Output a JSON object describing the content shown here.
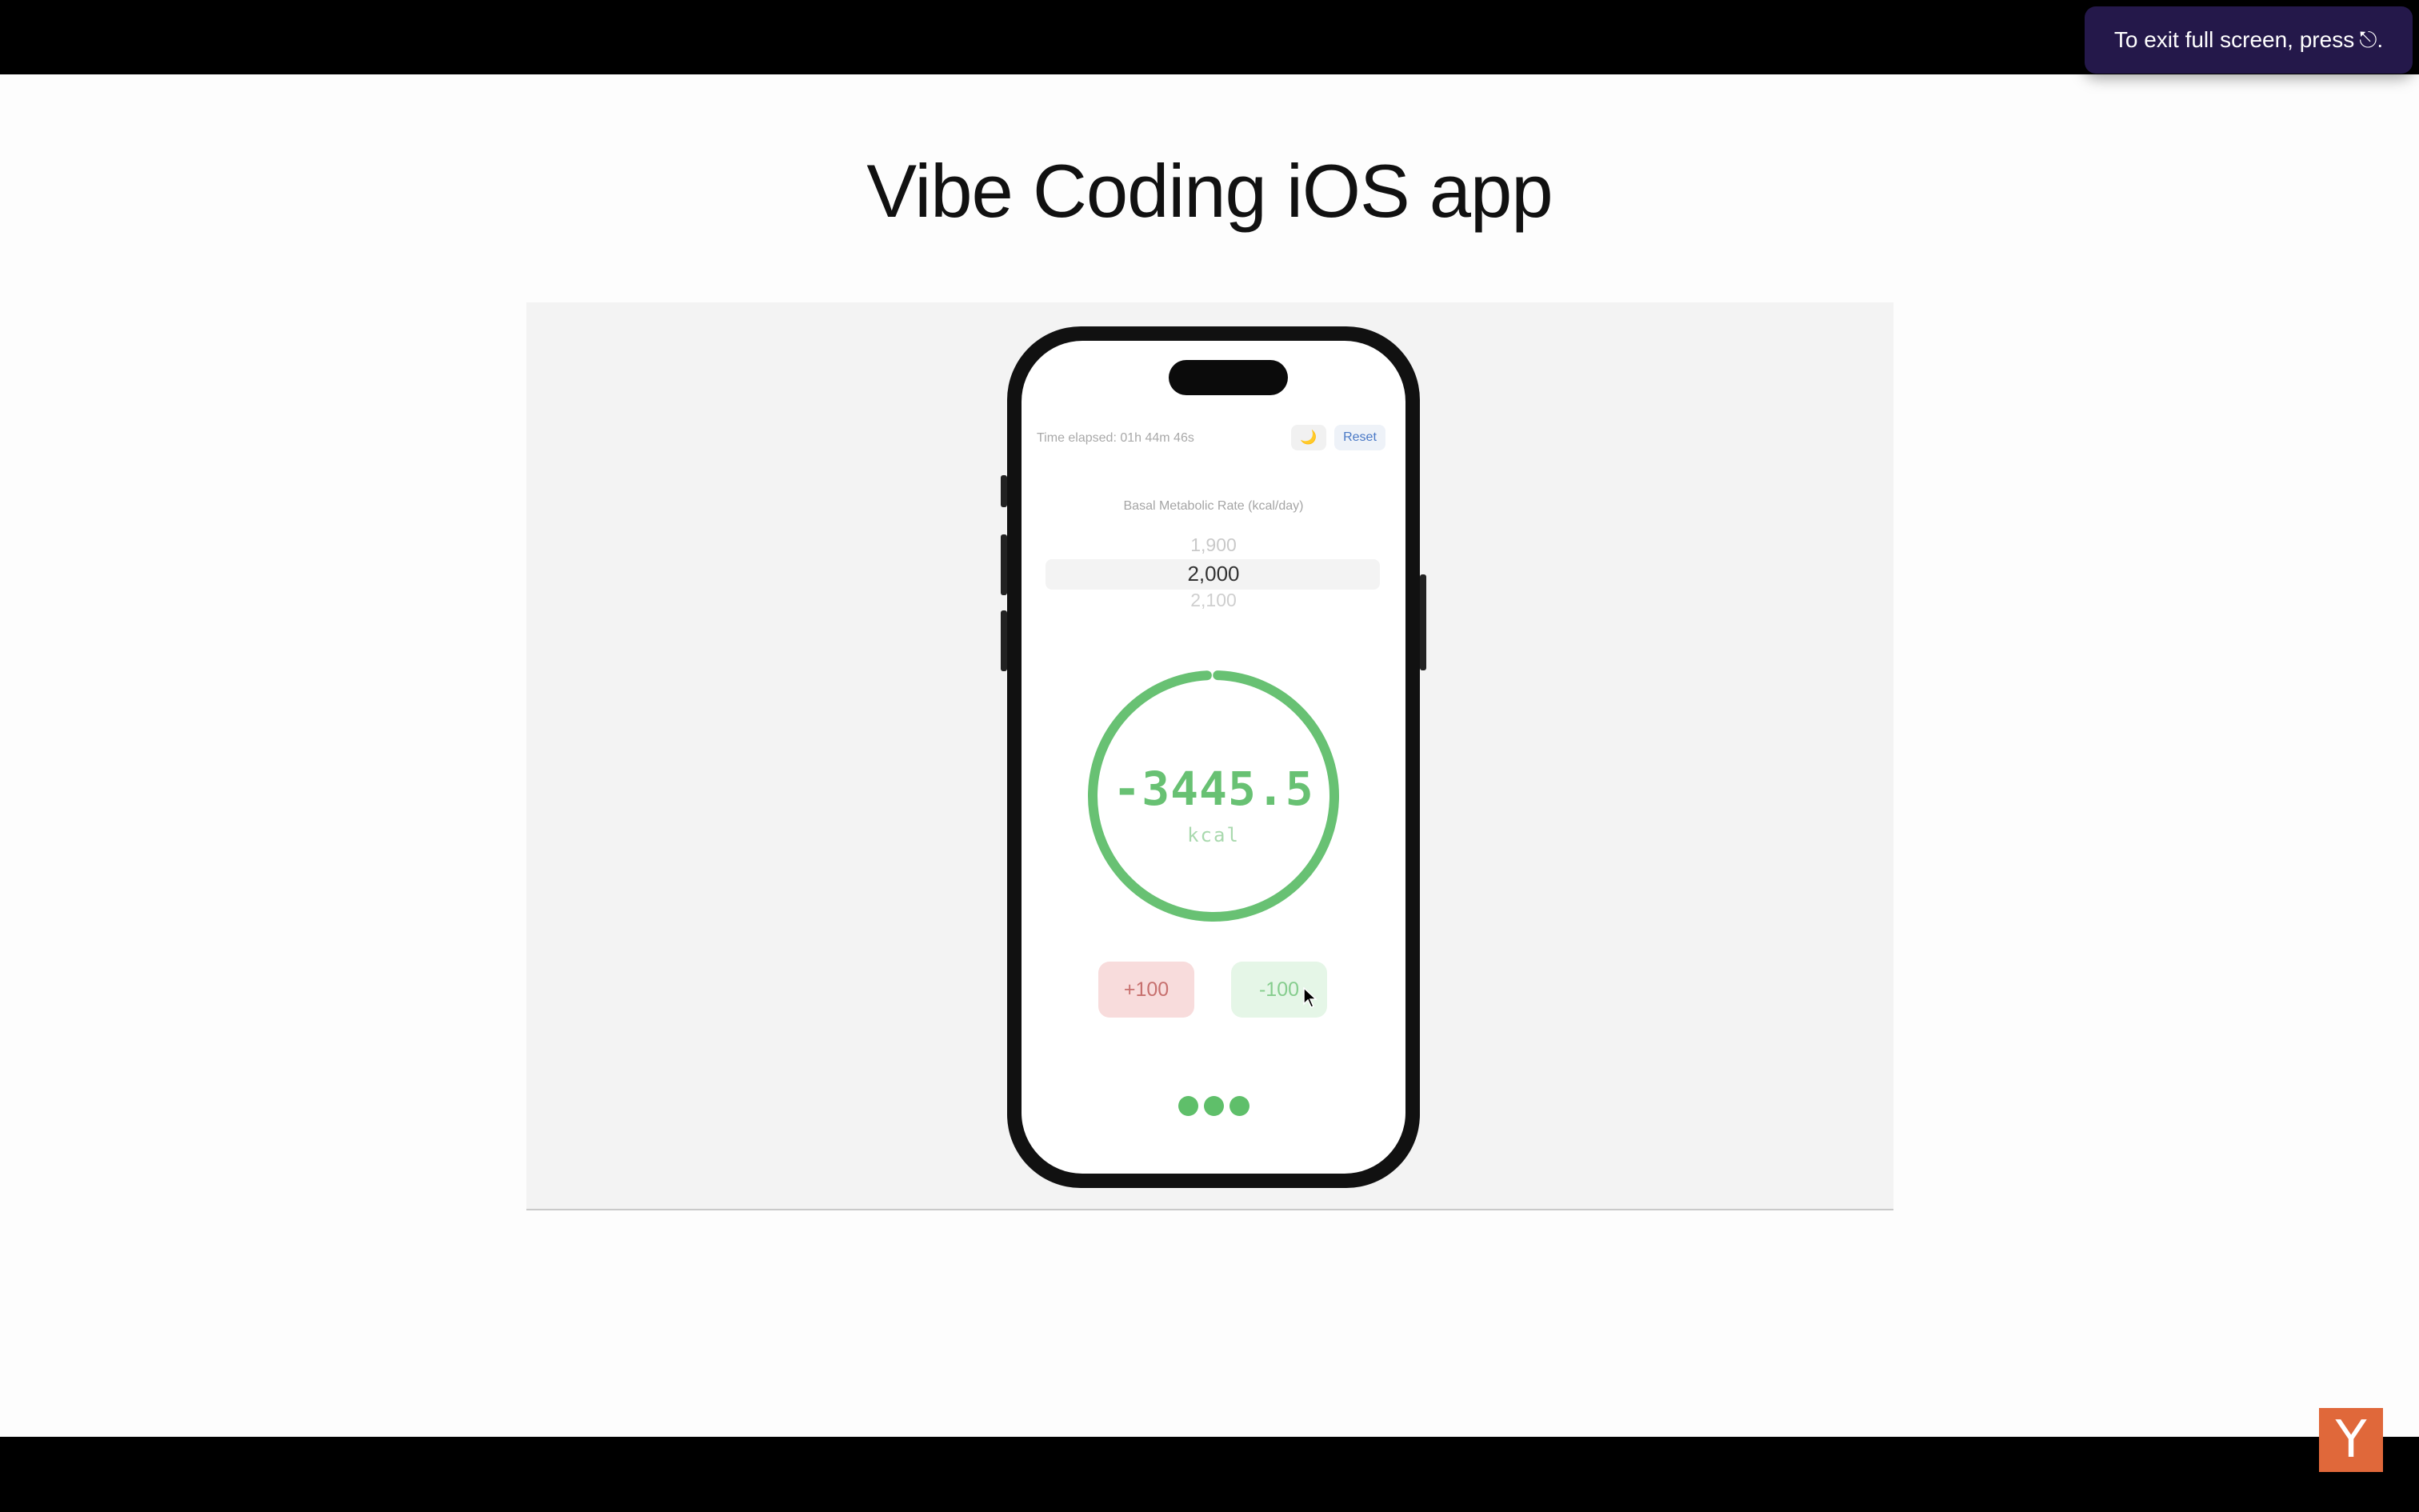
{
  "slide": {
    "title": "Vibe Coding iOS app"
  },
  "app": {
    "elapsed": "Time elapsed: 01h 44m 46s",
    "moon_icon": "moon-icon",
    "moon_glyph": "🌙",
    "reset_label": "Reset",
    "bmr_label": "Basal Metabolic Rate (kcal/day)",
    "picker": {
      "previous": "1,900",
      "selected": "2,000",
      "next": "2,100"
    },
    "ring_color": "#68c173",
    "calorie_value": "-3445.5",
    "calorie_unit": "kcal",
    "plus_label": "+100",
    "minus_label": "-100",
    "page_dots": 3
  },
  "toast": {
    "text": "To exit full screen, press",
    "key_glyph": "⎋."
  },
  "logo": {
    "letter": "Y",
    "color": "#e0683a"
  }
}
